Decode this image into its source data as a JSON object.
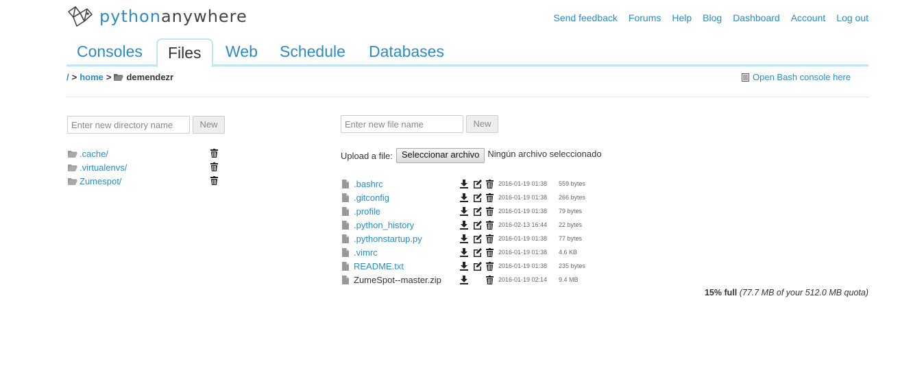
{
  "brand": {
    "name_part1": "python",
    "name_part2": "anywhere"
  },
  "topnav": [
    "Send feedback",
    "Forums",
    "Help",
    "Blog",
    "Dashboard",
    "Account",
    "Log out"
  ],
  "tabs": [
    {
      "label": "Consoles",
      "active": false
    },
    {
      "label": "Files",
      "active": true
    },
    {
      "label": "Web",
      "active": false
    },
    {
      "label": "Schedule",
      "active": false
    },
    {
      "label": "Databases",
      "active": false
    }
  ],
  "breadcrumb": {
    "root": "/",
    "sep": ">",
    "home": "home",
    "current": "demendezr"
  },
  "bash_link": "Open Bash console here",
  "dir_panel": {
    "placeholder": "Enter new directory name",
    "new_label": "New",
    "items": [
      ".cache/",
      ".virtualenvs/",
      "Zumespot/"
    ]
  },
  "file_panel": {
    "placeholder": "Enter new file name",
    "new_label": "New",
    "upload_label": "Upload a file:",
    "upload_button": "Seleccionar archivo",
    "upload_status": "Ningún archivo seleccionado",
    "files": [
      {
        "name": ".bashrc",
        "date": "2016-01-19 01:38",
        "size": "559 bytes",
        "editable": true
      },
      {
        "name": ".gitconfig",
        "date": "2016-01-19 01:38",
        "size": "266 bytes",
        "editable": true
      },
      {
        "name": ".profile",
        "date": "2016-01-19 01:38",
        "size": "79 bytes",
        "editable": true
      },
      {
        "name": ".python_history",
        "date": "2016-02-13 16:44",
        "size": "22 bytes",
        "editable": true
      },
      {
        "name": ".pythonstartup.py",
        "date": "2016-01-19 01:38",
        "size": "77 bytes",
        "editable": true
      },
      {
        "name": ".vimrc",
        "date": "2016-01-19 01:38",
        "size": "4.6 KB",
        "editable": true
      },
      {
        "name": "README.txt",
        "date": "2016-01-19 01:38",
        "size": "235 bytes",
        "editable": true
      },
      {
        "name": "ZumeSpot--master.zip",
        "date": "2016-01-19 02:14",
        "size": "9.4 MB",
        "editable": false
      }
    ]
  },
  "quota": {
    "percent": "15% full",
    "detail": "(77.7 MB of your 512.0 MB quota)"
  },
  "colors": {
    "link": "#2b8cc4",
    "tab_border": "#bfe6f5",
    "text": "#333333"
  }
}
